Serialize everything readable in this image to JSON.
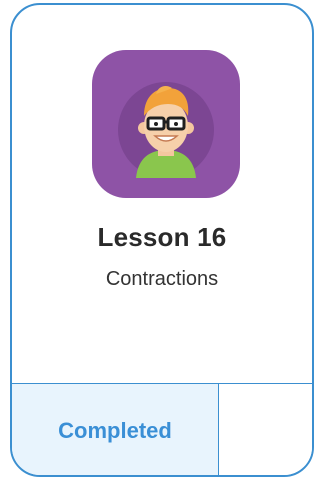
{
  "lesson": {
    "title": "Lesson 16",
    "subtitle": "Contractions",
    "avatar_icon": "teacher-avatar-icon",
    "status": "Completed"
  },
  "colors": {
    "border": "#3b8fd0",
    "avatar_bg": "#8e53a6",
    "status_bg": "#e8f4fd",
    "status_text": "#3a8fd6"
  }
}
